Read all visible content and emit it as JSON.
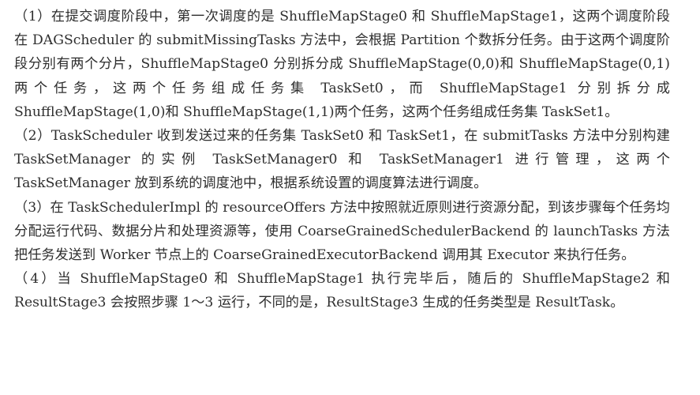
{
  "document": {
    "paragraphs": [
      "（1）在提交调度阶段中，第一次调度的是 ShuffleMapStage0 和 ShuffleMapStage1，这两个调度阶段在 DAGScheduler 的 submitMissingTasks 方法中，会根据 Partition 个数拆分任务。由于这两个调度阶段分别有两个分片，ShuffleMapStage0 分别拆分成 ShuffleMapStage(0,0)和 ShuffleMapStage(0,1)两个任务，这两个任务组成任务集 TaskSet0，而 ShuffleMapStage1 分别拆分成 ShuffleMapStage(1,0)和 ShuffleMapStage(1,1)两个任务，这两个任务组成任务集 TaskSet1。",
      "（2）TaskScheduler 收到发送过来的任务集 TaskSet0 和 TaskSet1，在 submitTasks 方法中分别构建 TaskSetManager 的实例 TaskSetManager0 和 TaskSetManager1 进行管理，这两个 TaskSetManager 放到系统的调度池中，根据系统设置的调度算法进行调度。",
      "（3）在 TaskSchedulerImpl 的 resourceOffers 方法中按照就近原则进行资源分配，到该步骤每个任务均分配运行代码、数据分片和处理资源等，使用 CoarseGrainedSchedulerBackend 的 launchTasks 方法把任务发送到 Worker 节点上的 CoarseGrainedExecutorBackend 调用其 Executor 来执行任务。",
      "（4）当 ShuffleMapStage0 和 ShuffleMapStage1 执行完毕后，随后的 ShuffleMapStage2 和 ResultStage3 会按照步骤 1～3 运行，不同的是，ResultStage3 生成的任务类型是 ResultTask。"
    ]
  }
}
